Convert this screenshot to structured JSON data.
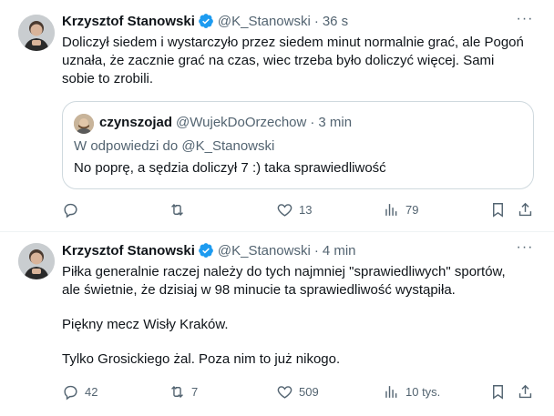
{
  "tweets": [
    {
      "author": {
        "name": "Krzysztof Stanowski",
        "handle": "@K_Stanowski",
        "dot": "·"
      },
      "time": "36 s",
      "text_lines": [
        "Doliczył siedem i wystarczyło przez siedem minut normalnie grać, ale Pogoń",
        "uznała, że zacznie grać na czas, wiec trzeba było doliczyć więcej. Sami",
        "sobie to zrobili."
      ],
      "quote": {
        "name": "czynszojad",
        "handle": "@WujekDoOrzechow",
        "dot": "·",
        "time": "3 min",
        "reply_prefix": "W odpowiedzi do",
        "reply_to": "@K_Stanowski",
        "text": "No poprę, a sędzia doliczył 7 :) taka sprawiedliwość"
      },
      "stats": {
        "replies": "",
        "retweets": "",
        "likes": "13",
        "views": "79"
      }
    },
    {
      "author": {
        "name": "Krzysztof Stanowski",
        "handle": "@K_Stanowski",
        "dot": "·"
      },
      "time": "4 min",
      "text_lines": [
        "Piłka generalnie raczej należy do tych najmniej \"sprawiedliwych\" sportów,",
        "ale świetnie, że dzisiaj w 98 minucie ta sprawiedliwość wystąpiła.",
        "",
        "Piękny mecz Wisły Kraków.",
        "",
        "Tylko Grosickiego żal. Poza nim to już nikogo."
      ],
      "stats": {
        "replies": "42",
        "retweets": "7",
        "likes": "509",
        "views": "10 tys."
      }
    }
  ],
  "more_icon": "···",
  "colors": {
    "accent": "#1d9bf0",
    "muted": "#536471",
    "text": "#0f1419",
    "border": "#cfd9de"
  }
}
